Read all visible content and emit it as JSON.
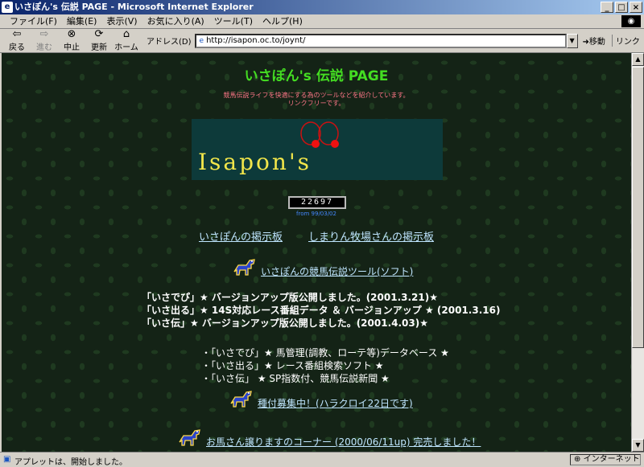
{
  "window": {
    "title": "いさぽん's 伝説 PAGE - Microsoft Internet Explorer",
    "icon": "ie-page-icon",
    "buttons": {
      "minimize": "_",
      "maximize": "□",
      "close": "×"
    }
  },
  "menu": {
    "items": [
      "ファイル(F)",
      "編集(E)",
      "表示(V)",
      "お気に入り(A)",
      "ツール(T)",
      "ヘルプ(H)"
    ],
    "logo_glyph": "◉"
  },
  "toolbar": {
    "back": {
      "label": "戻る",
      "glyph": "⇦"
    },
    "forward": {
      "label": "進む",
      "glyph": "⇨"
    },
    "stop": {
      "label": "中止",
      "glyph": "⊗"
    },
    "refresh": {
      "label": "更新",
      "glyph": "⟳"
    },
    "home": {
      "label": "ホーム",
      "glyph": "⌂"
    },
    "address_label": "アドレス(D)",
    "address_value": "http://isapon.oc.to/joynt/",
    "dropdown_glyph": "▼",
    "go_label": "➜移動",
    "links_label": "リンク"
  },
  "page": {
    "title": "いさぽん's 伝説 PAGE",
    "intro_line1": "競馬伝説ライフを快適にする為のツールなどを紹介しています。",
    "intro_line2": "リンクフリーです。",
    "banner_text": "Isapon's",
    "counter_value": "22697",
    "counter_since": "from 99/03/02",
    "bbs_links": [
      "いさぽんの掲示板",
      "しまりん牧場さんの掲示板"
    ],
    "tool_link": "いさぽんの競馬伝説ツール(ソフト)",
    "news": [
      "「いさでぴ」★ バージョンアップ版公開しました。(2001.3.21)★",
      "「いさ出る」★ 14S対応レース番組データ ＆ バージョンアップ ★ (2001.3.16)",
      "「いさ伝」★ バージョンアップ版公開しました。(2001.4.03)★"
    ],
    "software": [
      "・「いさでぴ」★ 馬管理(調教、ローテ等)データベース ★",
      "・「いさ出る」★ レース番組検索ソフト ★",
      "・「いさ伝」 ★ SP指数付、競馬伝説新聞 ★"
    ],
    "recruit_link": "種付募集中！(ハラクロイ22日です)",
    "sale_link": "お馬さん譲りますのコーナー (2000/06/11up) 完売しました！"
  },
  "status": {
    "text": "アプレットは、開始しました。",
    "zone": "インターネット"
  },
  "colors": {
    "title_green": "#44dd22",
    "intro_pink": "#ff7788",
    "banner_bg": "#0d3a3a",
    "banner_text": "#f2e64a",
    "link": "#bfe6ff",
    "page_bg": "#142316"
  }
}
